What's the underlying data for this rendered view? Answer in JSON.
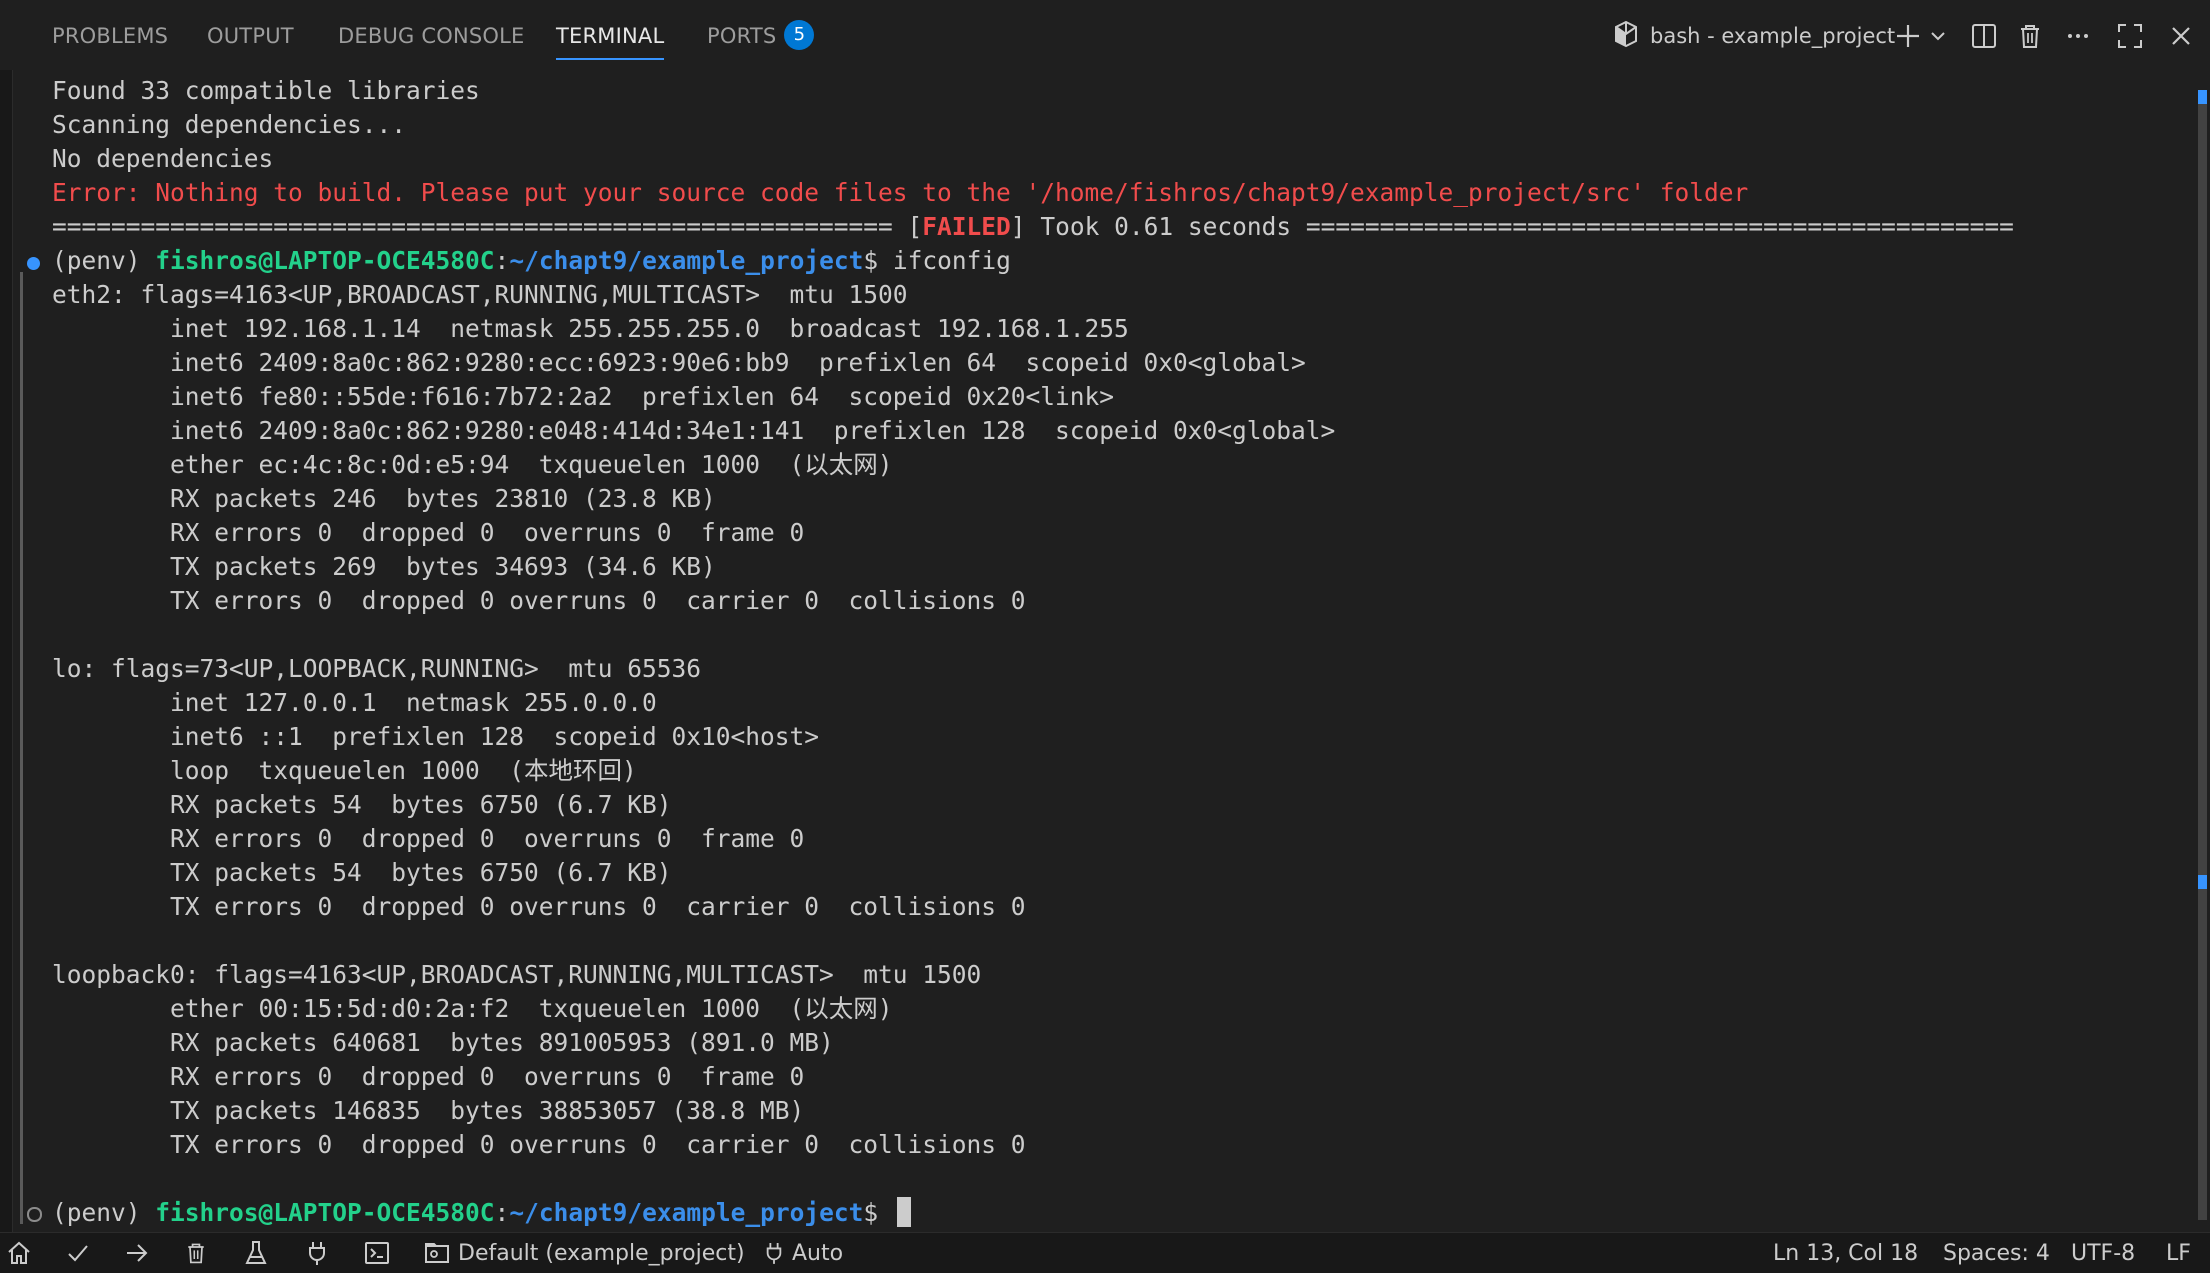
{
  "panel": {
    "tabs": [
      {
        "label": "PROBLEMS",
        "active": false
      },
      {
        "label": "OUTPUT",
        "active": false
      },
      {
        "label": "DEBUG CONSOLE",
        "active": false
      },
      {
        "label": "TERMINAL",
        "active": true
      },
      {
        "label": "PORTS",
        "active": false,
        "badge": "5"
      }
    ],
    "terminal_title": "bash - example_project",
    "actions": [
      "new-terminal-icon",
      "chevron-down-icon",
      "split-terminal-icon",
      "trash-icon",
      "more-icon",
      "maximize-icon",
      "close-icon"
    ]
  },
  "terminal": {
    "lines": [
      "Found 33 compatible libraries",
      "Scanning dependencies...",
      "No dependencies",
      "Error: Nothing to build. Please put your source code files to the '/home/fishros/chapt9/example_project/src' folder",
      "eth2: flags=4163<UP,BROADCAST,RUNNING,MULTICAST>  mtu 1500",
      "        inet 192.168.1.14  netmask 255.255.255.0  broadcast 192.168.1.255",
      "        inet6 2409:8a0c:862:9280:ecc:6923:90e6:bb9  prefixlen 64  scopeid 0x0<global>",
      "        inet6 fe80::55de:f616:7b72:2a2  prefixlen 64  scopeid 0x20<link>",
      "        inet6 2409:8a0c:862:9280:e048:414d:34e1:141  prefixlen 128  scopeid 0x0<global>",
      "        ether ec:4c:8c:0d:e5:94  txqueuelen 1000  (以太网)",
      "        RX packets 246  bytes 23810 (23.8 KB)",
      "        RX errors 0  dropped 0  overruns 0  frame 0",
      "        TX packets 269  bytes 34693 (34.6 KB)",
      "        TX errors 0  dropped 0 overruns 0  carrier 0  collisions 0",
      "",
      "lo: flags=73<UP,LOOPBACK,RUNNING>  mtu 65536",
      "        inet 127.0.0.1  netmask 255.0.0.0",
      "        inet6 ::1  prefixlen 128  scopeid 0x10<host>",
      "        loop  txqueuelen 1000  (本地环回)",
      "        RX packets 54  bytes 6750 (6.7 KB)",
      "        RX errors 0  dropped 0  overruns 0  frame 0",
      "        TX packets 54  bytes 6750 (6.7 KB)",
      "        TX errors 0  dropped 0 overruns 0  carrier 0  collisions 0",
      "",
      "loopback0: flags=4163<UP,BROADCAST,RUNNING,MULTICAST>  mtu 1500",
      "        ether 00:15:5d:d0:2a:f2  txqueuelen 1000  (以太网)",
      "        RX packets 640681  bytes 891005953 (891.0 MB)",
      "        RX errors 0  dropped 0  overruns 0  frame 0",
      "        TX packets 146835  bytes 38853057 (38.8 MB)",
      "        TX errors 0  dropped 0 overruns 0  carrier 0  collisions 0",
      ""
    ],
    "separator_left": "=========================================================",
    "separator_right": "================================================",
    "failed_label": "FAILED",
    "took_text": "Took 0.61 seconds",
    "prompt": {
      "venv": "(penv)",
      "user_host": "fishros@LAPTOP-OCE4580C",
      "colon": ":",
      "path": "~/chapt9/example_project",
      "dollar": "$"
    },
    "command": "ifconfig"
  },
  "statusbar": {
    "items_left": [
      "home-icon",
      "check-icon",
      "arrow-right-icon",
      "trash-icon",
      "flask-icon",
      "plug-icon",
      "terminal-icon"
    ],
    "env_label": "Default (example_project)",
    "auto_label": "Auto",
    "cursor_position": "Ln 13, Col 18",
    "spaces": "Spaces: 4",
    "encoding": "UTF-8",
    "eol": "LF"
  },
  "colors": {
    "background": "#1f1f1f",
    "error": "#f14c4c",
    "user_host": "#23d18b",
    "path": "#3b8eea",
    "accent": "#0078d4"
  }
}
